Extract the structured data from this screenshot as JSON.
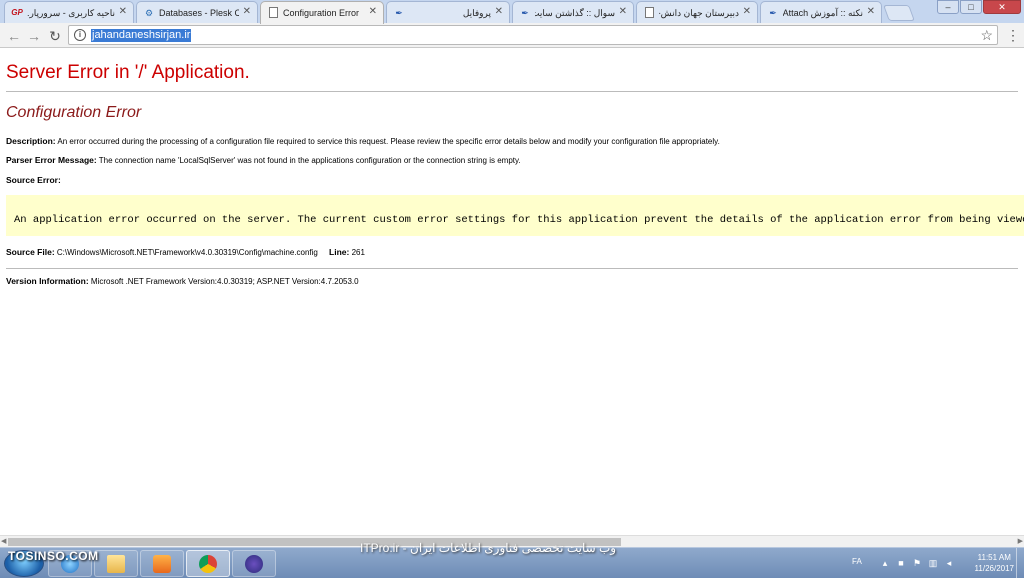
{
  "browser": {
    "tabs": [
      {
        "title": "ناحیه کاربری - سرورپار...",
        "icon": "gp-favicon",
        "rtl": true
      },
      {
        "title": "Databases - Plesk C",
        "icon": "plesk-favicon",
        "rtl": false
      },
      {
        "title": "Configuration Error",
        "icon": "page-favicon",
        "rtl": false,
        "active": true
      },
      {
        "title": "پروفایل",
        "icon": "pen-favicon",
        "rtl": true
      },
      {
        "title": "سوال :: گذاشتن سایت رو",
        "icon": "pen-favicon",
        "rtl": true
      },
      {
        "title": "دبیرستان جهان دانش-دور",
        "icon": "page-favicon",
        "rtl": true
      },
      {
        "title": "نکته :: آموزش Attach",
        "icon": "pen-favicon",
        "rtl": true
      }
    ],
    "address": "jahandaneshsirjan.ir"
  },
  "page": {
    "title": "Server Error in '/' Application.",
    "subtitle": "Configuration Error",
    "description_label": "Description:",
    "description_text": "An error occurred during the processing of a configuration file required to service this request. Please review the specific error details below and modify your configuration file appropriately.",
    "parser_label": "Parser Error Message:",
    "parser_text": "The connection name 'LocalSqlServer' was not found in the applications configuration or the connection string is empty.",
    "source_error_label": "Source Error:",
    "source_error_text": "An application error occurred on the server. The current custom error settings for this application prevent the details of the application error from being viewed remo",
    "source_file_label": "Source File:",
    "source_file_value": "C:\\Windows\\Microsoft.NET\\Framework\\v4.0.30319\\Config\\machine.config",
    "line_label": "Line:",
    "line_value": "261",
    "version_label": "Version Information:",
    "version_text": "Microsoft .NET Framework Version:4.0.30319; ASP.NET Version:4.7.2053.0"
  },
  "taskbar": {
    "watermark": "TOSINSO.COM",
    "banner": "ITPro.ir - وب سایت تخصصی فناوری اطلاعات ایران",
    "language": "FA",
    "time": "11:51 AM",
    "date": "11/26/2017"
  },
  "colors": {
    "heading": "#cc0000",
    "subheading": "#8b1a1a",
    "error_box": "#ffffcc",
    "url_highlight": "#3a7bd5"
  }
}
